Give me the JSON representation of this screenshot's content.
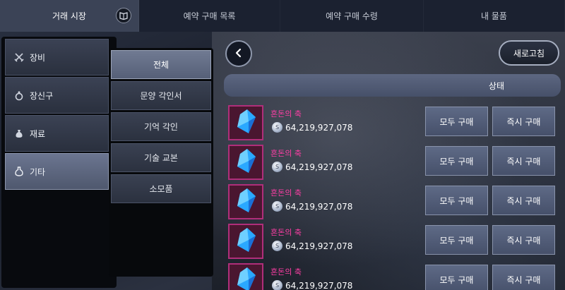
{
  "tabs": [
    {
      "label": "거래 시장",
      "active": true
    },
    {
      "label": "예약 구매 목록",
      "active": false
    },
    {
      "label": "예약 구매 수령",
      "active": false
    },
    {
      "label": "내 물품",
      "active": false
    }
  ],
  "categories": [
    {
      "label": "장비",
      "icon": "crossed-swords-icon",
      "active": false
    },
    {
      "label": "장신구",
      "icon": "ring-icon",
      "active": false
    },
    {
      "label": "재료",
      "icon": "pouch-icon",
      "active": false
    },
    {
      "label": "기타",
      "icon": "potion-icon",
      "active": true
    }
  ],
  "subcategories": [
    {
      "label": "전체",
      "active": true
    },
    {
      "label": "문양 각인서",
      "active": false
    },
    {
      "label": "기억 각인",
      "active": false
    },
    {
      "label": "기술 교본",
      "active": false
    },
    {
      "label": "소모품",
      "active": false
    }
  ],
  "toolbar": {
    "refresh_label": "새로고침"
  },
  "list": {
    "status_header": "상태",
    "items": [
      {
        "name": "혼돈의 축",
        "price": "64,219,927,078",
        "buy_all": "모두 구매",
        "buy_now": "즉시 구매"
      },
      {
        "name": "혼돈의 축",
        "price": "64,219,927,078",
        "buy_all": "모두 구매",
        "buy_now": "즉시 구매"
      },
      {
        "name": "혼돈의 축",
        "price": "64,219,927,078",
        "buy_all": "모두 구매",
        "buy_now": "즉시 구매"
      },
      {
        "name": "혼돈의 축",
        "price": "64,219,927,078",
        "buy_all": "모두 구매",
        "buy_now": "즉시 구매"
      },
      {
        "name": "혼돈의 축",
        "price": "64,219,927,078",
        "buy_all": "모두 구매",
        "buy_now": "즉시 구매"
      }
    ]
  },
  "colors": {
    "item_name": "#ff3ea5",
    "item_frame": "#b02e7a",
    "gem": "#2aa8ff"
  }
}
